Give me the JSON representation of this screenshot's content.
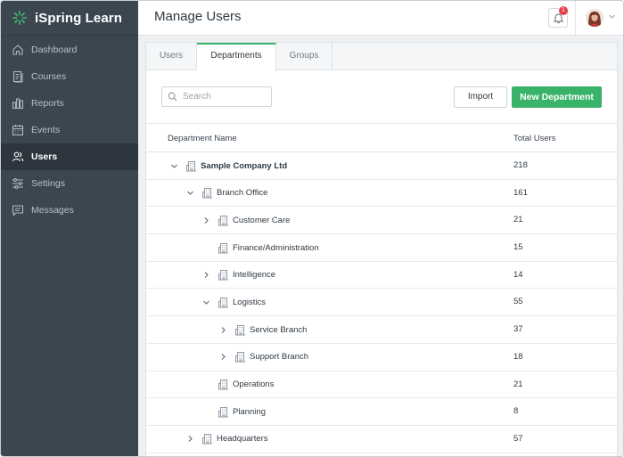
{
  "brand": {
    "name": "iSpring Learn"
  },
  "sidebar": {
    "items": [
      {
        "label": "Dashboard",
        "icon": "home-icon",
        "active": false
      },
      {
        "label": "Courses",
        "icon": "courses-icon",
        "active": false
      },
      {
        "label": "Reports",
        "icon": "bar-chart-icon",
        "active": false
      },
      {
        "label": "Events",
        "icon": "calendar-icon",
        "active": false
      },
      {
        "label": "Users",
        "icon": "users-icon",
        "active": true
      },
      {
        "label": "Settings",
        "icon": "sliders-icon",
        "active": false
      },
      {
        "label": "Messages",
        "icon": "message-icon",
        "active": false
      }
    ]
  },
  "header": {
    "title": "Manage Users",
    "notification_count": "1"
  },
  "tabs": [
    {
      "label": "Users",
      "active": false
    },
    {
      "label": "Departments",
      "active": true
    },
    {
      "label": "Groups",
      "active": false
    }
  ],
  "toolbar": {
    "search_placeholder": "Search",
    "import_label": "Import",
    "new_department_label": "New Department"
  },
  "table": {
    "columns": [
      "Department Name",
      "Total Users"
    ],
    "rows": [
      {
        "name": "Sample Company Ltd",
        "total": "218",
        "level": 0,
        "chevron": "down",
        "bold": true
      },
      {
        "name": "Branch Office",
        "total": "161",
        "level": 1,
        "chevron": "down",
        "bold": false
      },
      {
        "name": "Customer Care",
        "total": "21",
        "level": 2,
        "chevron": "right",
        "bold": false
      },
      {
        "name": "Finance/Administration",
        "total": "15",
        "level": 2,
        "chevron": "none",
        "bold": false
      },
      {
        "name": "Intelligence",
        "total": "14",
        "level": 2,
        "chevron": "right",
        "bold": false
      },
      {
        "name": "Logistics",
        "total": "55",
        "level": 2,
        "chevron": "down",
        "bold": false
      },
      {
        "name": "Service Branch",
        "total": "37",
        "level": 3,
        "chevron": "right",
        "bold": false
      },
      {
        "name": "Support Branch",
        "total": "18",
        "level": 3,
        "chevron": "right",
        "bold": false
      },
      {
        "name": "Operations",
        "total": "21",
        "level": 2,
        "chevron": "none",
        "bold": false
      },
      {
        "name": "Planning",
        "total": "8",
        "level": 2,
        "chevron": "none",
        "bold": false
      },
      {
        "name": "Headquarters",
        "total": "57",
        "level": 1,
        "chevron": "right",
        "bold": false
      }
    ]
  },
  "colors": {
    "sidebar_bg": "#3c4651",
    "sidebar_active_bg": "#2d353e",
    "accent_green": "#3ab36a",
    "badge_red": "#e53e4a"
  }
}
